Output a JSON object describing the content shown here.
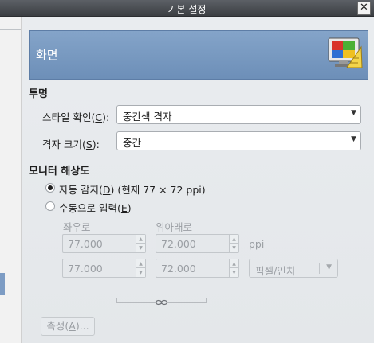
{
  "window": {
    "title": "기본 설정",
    "close_glyph": "✕"
  },
  "header": {
    "title": "화면",
    "icon": "monitor-icon"
  },
  "transparency": {
    "section_title": "투명",
    "check_style_label": "스타일 확인(C):",
    "check_style_value": "중간색 격자",
    "check_size_label": "격자 크기(S):",
    "check_size_value": "중간"
  },
  "resolution": {
    "section_title": "모니터 해상도",
    "auto_label": "자동 감지(D) (현재 77 × 72 ppi)",
    "auto_checked": true,
    "manual_label": "수동으로 입력(E)",
    "manual_checked": false,
    "horizontal_label": "좌우로",
    "vertical_label": "위아래로",
    "row1": {
      "horizontal": "77.000",
      "vertical": "72.000",
      "unit": "ppi"
    },
    "row2": {
      "horizontal": "77.000",
      "vertical": "72.000",
      "unit": "픽셀/인치"
    },
    "measure_button": "측정(A)..."
  },
  "colors": {
    "header_bg": "#7a9bc3",
    "title_bar": "#4a4d52"
  }
}
